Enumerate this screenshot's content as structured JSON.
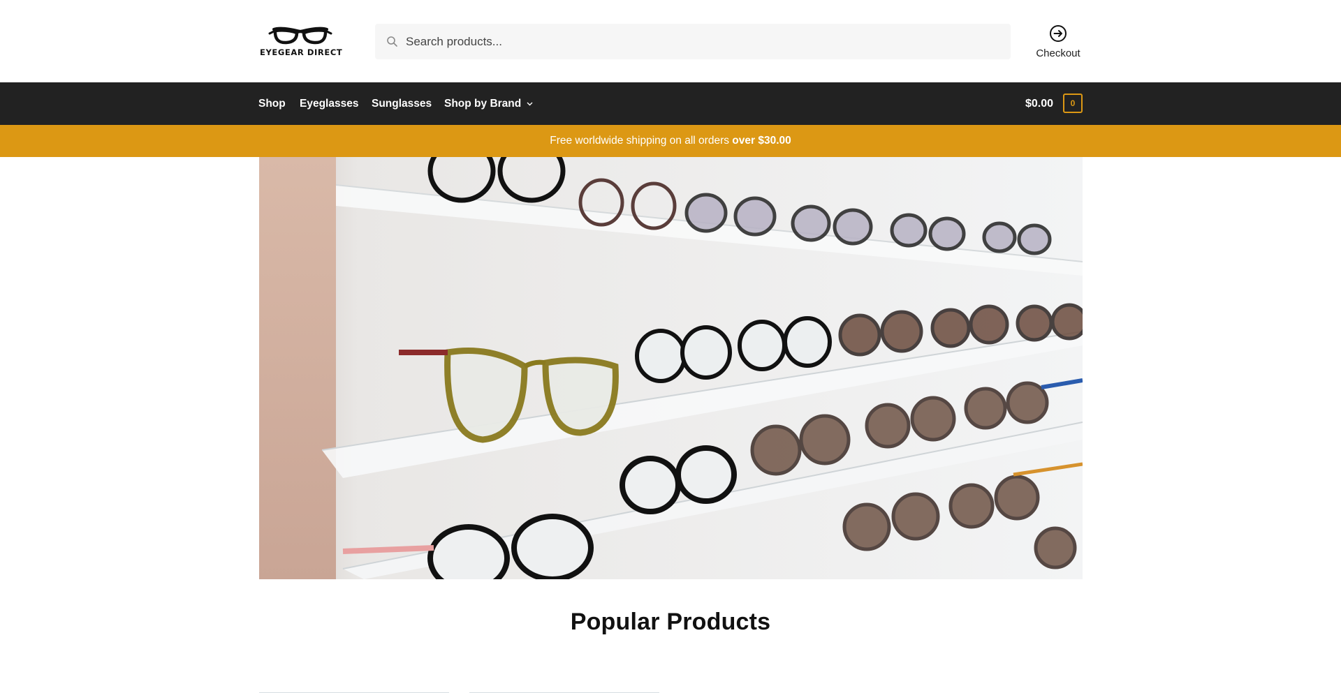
{
  "brand": {
    "logo_text": "EYEGEAR DIRECT",
    "logo_icon": "eyeglasses-logo-icon"
  },
  "search": {
    "placeholder": "Search products...",
    "value": "",
    "icon": "search-icon"
  },
  "header": {
    "checkout_label": "Checkout",
    "checkout_icon": "arrow-circle-right-icon"
  },
  "nav": {
    "items": [
      {
        "label": "Shop"
      },
      {
        "label": "Eyeglasses"
      },
      {
        "label": "Sunglasses"
      },
      {
        "label": "Shop by Brand",
        "has_dropdown": true
      }
    ],
    "cart_total": "$0.00",
    "cart_count": "0"
  },
  "promo": {
    "text": "Free worldwide shipping on all orders ",
    "emphasis": "over $30.00"
  },
  "hero": {
    "alt": "Eyeglasses and sunglasses displayed on acrylic shelves"
  },
  "section": {
    "title": "Popular Products"
  },
  "colors": {
    "nav_bg": "#222222",
    "accent": "#dc9814",
    "search_bg": "#f6f6f6"
  }
}
